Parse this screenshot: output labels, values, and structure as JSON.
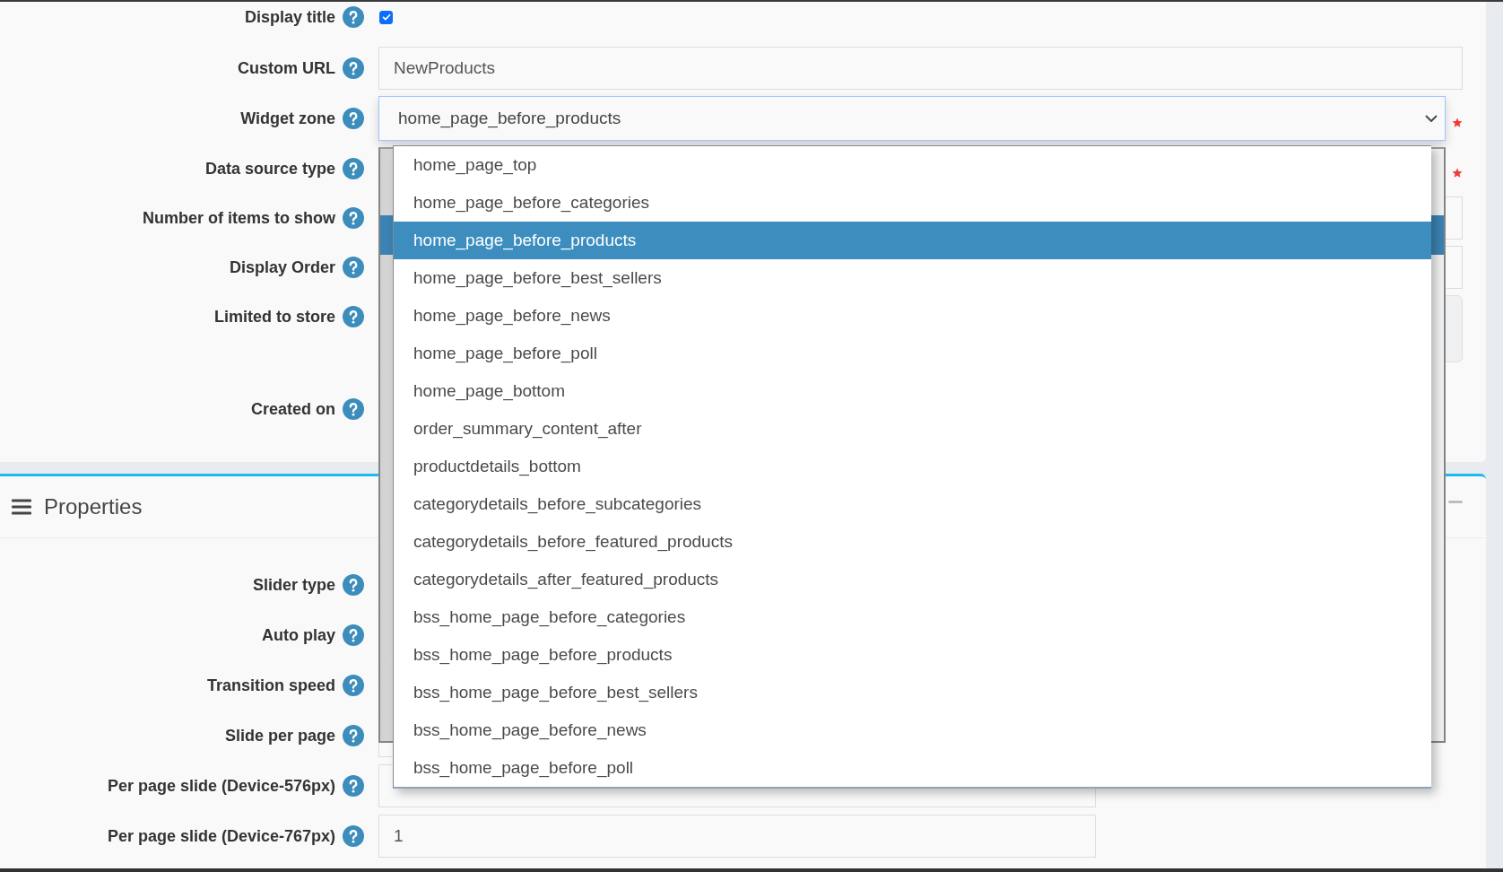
{
  "general": {
    "fields": [
      {
        "label": "Display title",
        "kind": "checkbox",
        "checked": true,
        "required": false
      },
      {
        "label": "Custom URL",
        "kind": "input",
        "value": "NewProducts",
        "required": false
      },
      {
        "label": "Widget zone",
        "kind": "select",
        "value": "home_page_before_products",
        "required": true,
        "expanded": true,
        "options": [
          {
            "label": "home_page_top",
            "selected": false
          },
          {
            "label": "home_page_before_categories",
            "selected": false
          },
          {
            "label": "home_page_before_products",
            "selected": true
          },
          {
            "label": "home_page_before_best_sellers",
            "selected": false
          },
          {
            "label": "home_page_before_news",
            "selected": false
          },
          {
            "label": "home_page_before_poll",
            "selected": false
          },
          {
            "label": "home_page_bottom",
            "selected": false
          },
          {
            "label": "order_summary_content_after",
            "selected": false
          },
          {
            "label": "productdetails_bottom",
            "selected": false
          },
          {
            "label": "categorydetails_before_subcategories",
            "selected": false
          },
          {
            "label": "categorydetails_before_featured_products",
            "selected": false
          },
          {
            "label": "categorydetails_after_featured_products",
            "selected": false
          },
          {
            "label": "bss_home_page_before_categories",
            "selected": false
          },
          {
            "label": "bss_home_page_before_products",
            "selected": false
          },
          {
            "label": "bss_home_page_before_best_sellers",
            "selected": false
          },
          {
            "label": "bss_home_page_before_news",
            "selected": false
          },
          {
            "label": "bss_home_page_before_poll",
            "selected": false
          }
        ]
      },
      {
        "label": "Data source type",
        "required": true
      },
      {
        "label": "Number of items to show",
        "kind": "input",
        "required": false
      },
      {
        "label": "Display Order",
        "kind": "input",
        "required": false
      },
      {
        "label": "Limited to store",
        "kind": "multiselect",
        "required": false
      },
      {
        "label": "Created on",
        "required": false
      }
    ]
  },
  "properties": {
    "title": "Properties",
    "fields": [
      {
        "label": "Slider type",
        "required": false
      },
      {
        "label": "Auto play",
        "required": false
      },
      {
        "label": "Transition speed",
        "required": false
      },
      {
        "label": "Slide per page",
        "kind": "input",
        "required": false
      },
      {
        "label": "Per page slide (Device-576px)",
        "kind": "input",
        "required": false
      },
      {
        "label": "Per page slide (Device-767px)",
        "kind": "input",
        "value": "1",
        "required": false
      }
    ]
  }
}
